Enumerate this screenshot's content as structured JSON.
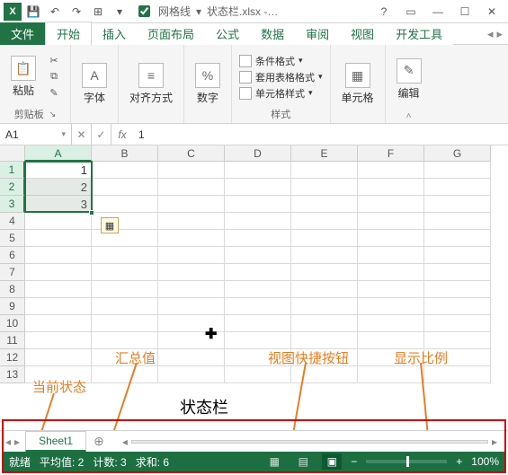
{
  "titlebar": {
    "gridlines_label": "网格线",
    "filename": "状态栏.xlsx -…"
  },
  "tabs": {
    "file": "文件",
    "home": "开始",
    "insert": "插入",
    "layout": "页面布局",
    "formulas": "公式",
    "data": "数据",
    "review": "审阅",
    "view": "视图",
    "dev": "开发工具"
  },
  "ribbon": {
    "paste": "粘贴",
    "clipboard": "剪贴板",
    "font": "字体",
    "align": "对齐方式",
    "number": "数字",
    "cond_fmt": "条件格式",
    "tbl_fmt": "套用表格格式",
    "cell_style": "单元格样式",
    "styles": "样式",
    "cells": "单元格",
    "editing": "编辑"
  },
  "formula_bar": {
    "name": "A1",
    "value": "1"
  },
  "columns": [
    "A",
    "B",
    "C",
    "D",
    "E",
    "F",
    "G"
  ],
  "rows": [
    "1",
    "2",
    "3",
    "4",
    "5",
    "6",
    "7",
    "8",
    "9",
    "10",
    "11",
    "12",
    "13"
  ],
  "cells": {
    "a1": "1",
    "a2": "2",
    "a3": "3"
  },
  "annotations": {
    "current_state": "当前状态",
    "summary": "汇总值",
    "view_buttons": "视图快捷按钮",
    "zoom": "显示比例",
    "statusbar_title": "状态栏"
  },
  "sheet": {
    "name": "Sheet1"
  },
  "status": {
    "ready": "就绪",
    "avg": "平均值: 2",
    "count": "计数: 3",
    "sum": "求和: 6",
    "zoom": "100%"
  }
}
